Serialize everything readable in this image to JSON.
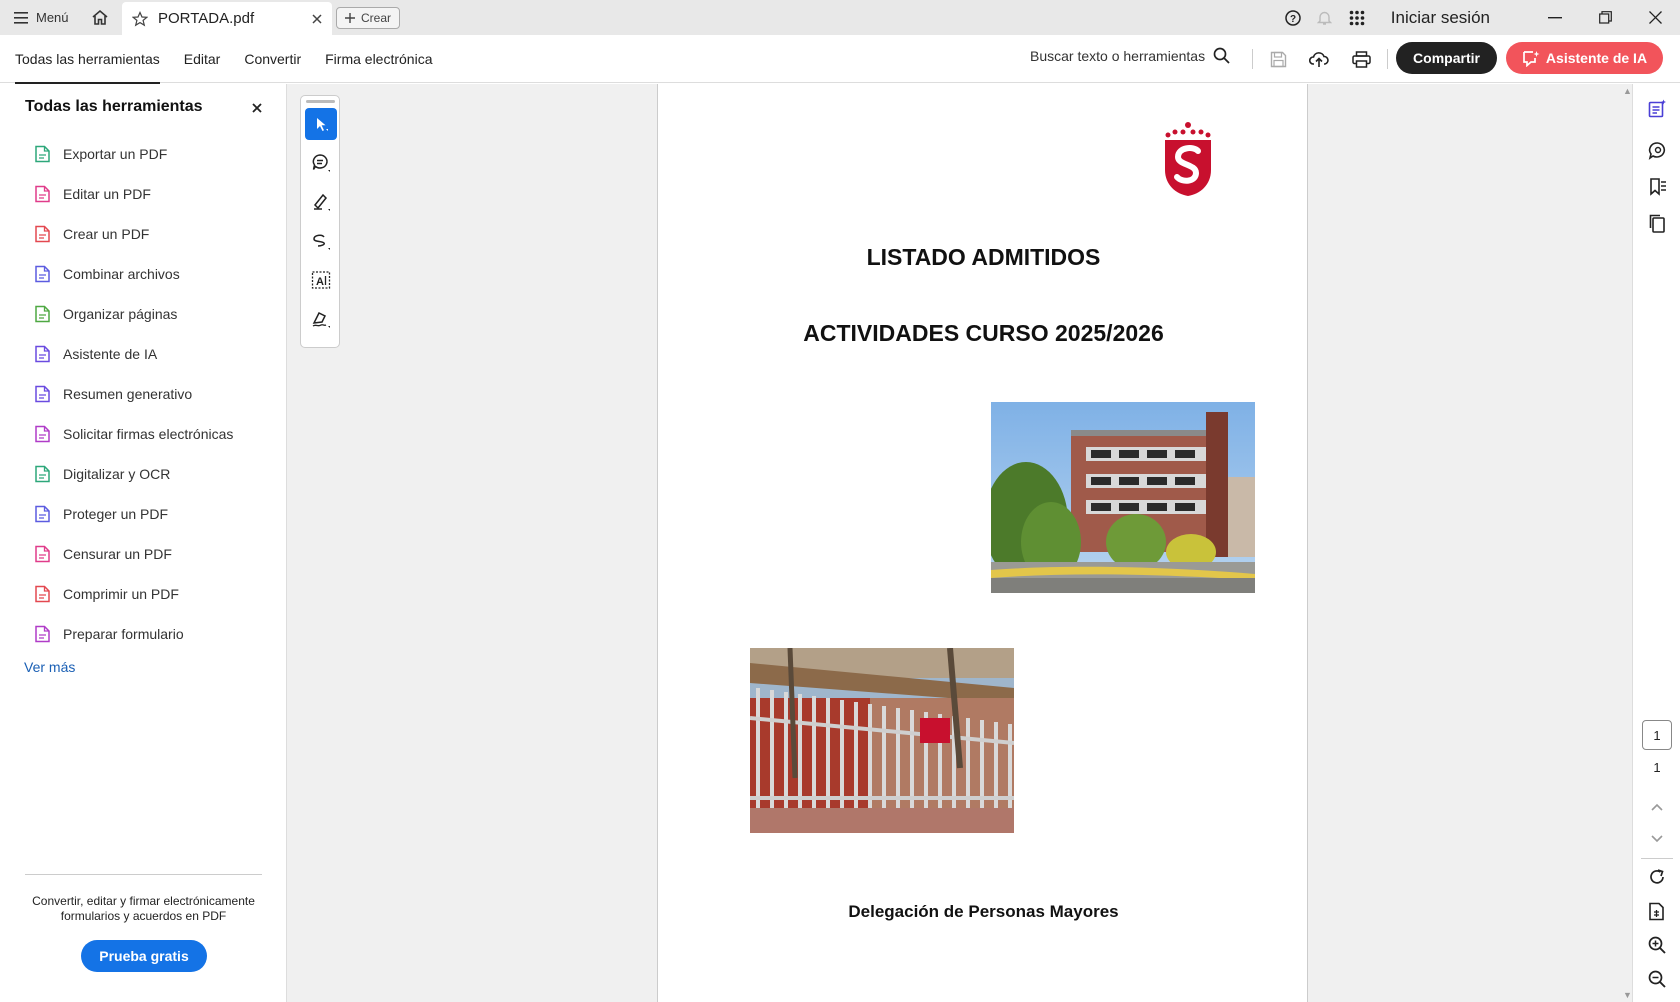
{
  "titlebar": {
    "menu_label": "Menú",
    "tab_title": "PORTADA.pdf",
    "create_label": "Crear",
    "signin_label": "Iniciar sesión"
  },
  "toolbar": {
    "nav": [
      "Todas las herramientas",
      "Editar",
      "Convertir",
      "Firma electrónica"
    ],
    "search_label": "Buscar texto o herramientas",
    "share_label": "Compartir",
    "ai_label": "Asistente de IA"
  },
  "left_panel": {
    "title": "Todas las herramientas",
    "tools": [
      {
        "label": "Exportar un PDF",
        "icon": "export-pdf-icon",
        "color": "#2da77a"
      },
      {
        "label": "Editar un PDF",
        "icon": "edit-pdf-icon",
        "color": "#e03c8a"
      },
      {
        "label": "Crear un PDF",
        "icon": "create-pdf-icon",
        "color": "#e34850"
      },
      {
        "label": "Combinar archivos",
        "icon": "combine-files-icon",
        "color": "#5c5ce0"
      },
      {
        "label": "Organizar páginas",
        "icon": "organize-pages-icon",
        "color": "#4fa842"
      },
      {
        "label": "Asistente de IA",
        "icon": "ai-assistant-icon",
        "color": "#6a4be0"
      },
      {
        "label": "Resumen generativo",
        "icon": "generative-summary-icon",
        "color": "#6a4be0"
      },
      {
        "label": "Solicitar firmas electrónicas",
        "icon": "request-signatures-icon",
        "color": "#b03cc8"
      },
      {
        "label": "Digitalizar y OCR",
        "icon": "scan-ocr-icon",
        "color": "#2da77a"
      },
      {
        "label": "Proteger un PDF",
        "icon": "protect-pdf-icon",
        "color": "#5c5ce0"
      },
      {
        "label": "Censurar un PDF",
        "icon": "redact-pdf-icon",
        "color": "#e03c8a"
      },
      {
        "label": "Comprimir un PDF",
        "icon": "compress-pdf-icon",
        "color": "#e34850"
      },
      {
        "label": "Preparar formulario",
        "icon": "prepare-form-icon",
        "color": "#b03cc8"
      }
    ],
    "see_more": "Ver más",
    "promo_text": "Convertir, editar y firmar electrónicamente formularios y acuerdos en PDF",
    "trial_label": "Prueba gratis"
  },
  "document": {
    "title1": "LISTADO ADMITIDOS",
    "title2": "ACTIVIDADES CURSO 2025/2026",
    "footer": "Delegación de Personas Mayores",
    "logo_color": "#c8102e"
  },
  "pagination": {
    "current_page": "1",
    "total_pages": "1"
  },
  "colors": {
    "accent_blue": "#1473e6",
    "ai_button": "#f2545b",
    "share_button": "#222222"
  }
}
